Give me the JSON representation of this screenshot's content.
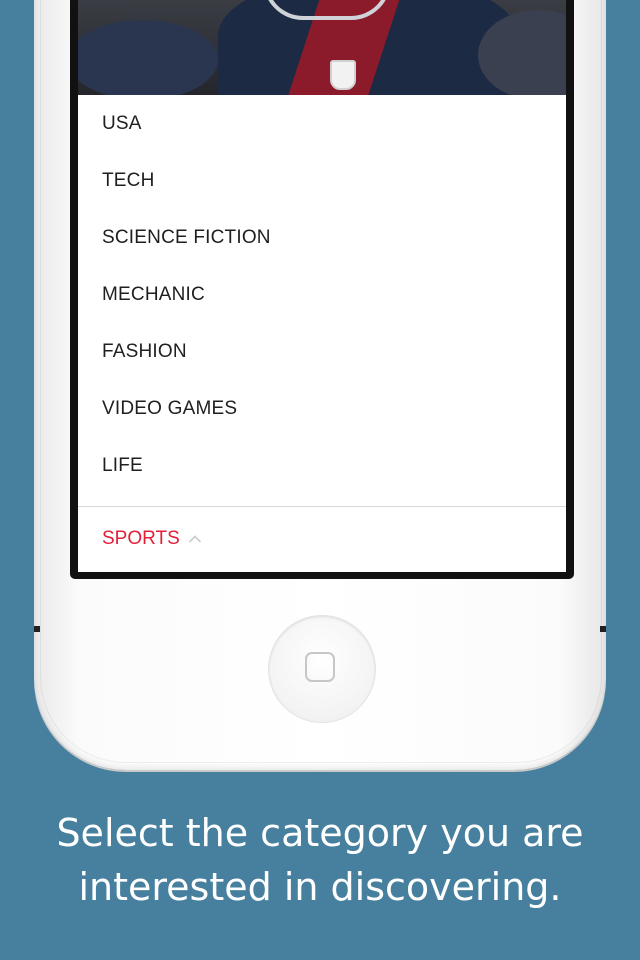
{
  "menu": {
    "items": [
      {
        "label": "USA"
      },
      {
        "label": "TECH"
      },
      {
        "label": "SCIENCE FICTION"
      },
      {
        "label": "MECHANIC"
      },
      {
        "label": "FASHION"
      },
      {
        "label": "VIDEO GAMES"
      },
      {
        "label": "LIFE"
      }
    ],
    "selected_label": "SPORTS",
    "selected_icon": "chevron-up-icon"
  },
  "caption": {
    "line1": "Select the category you are",
    "line2": "interested in discovering."
  },
  "colors": {
    "background": "#47809f",
    "accent": "#e2203a",
    "menu_text": "#1f1f1f"
  }
}
